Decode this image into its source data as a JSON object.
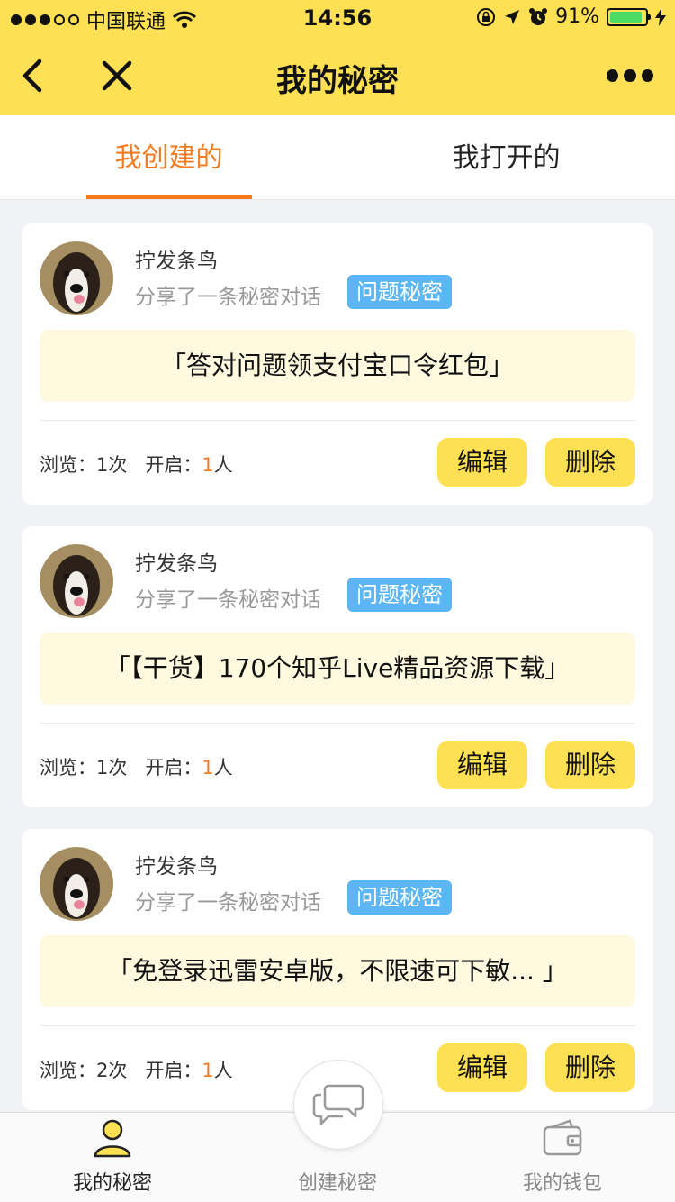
{
  "status_bar": {
    "carrier": "中国联通",
    "time": "14:56",
    "battery_percent": "91%",
    "battery_level": 0.91
  },
  "nav": {
    "title": "我的秘密"
  },
  "tabs": [
    {
      "label": "我创建的",
      "active": true
    },
    {
      "label": "我打开的",
      "active": false
    }
  ],
  "cards": [
    {
      "user": "拧发条鸟",
      "action": "分享了一条秘密对话",
      "badge": "问题秘密",
      "content": "「答对问题领支付宝口令红包」",
      "views_label": "浏览：",
      "views": "1次",
      "opens_label": "开启：",
      "opens_num": "1",
      "opens_unit": "人",
      "edit": "编辑",
      "delete": "删除"
    },
    {
      "user": "拧发条鸟",
      "action": "分享了一条秘密对话",
      "badge": "问题秘密",
      "content": "「【干货】170个知乎Live精品资源下载」",
      "views_label": "浏览：",
      "views": "1次",
      "opens_label": "开启：",
      "opens_num": "1",
      "opens_unit": "人",
      "edit": "编辑",
      "delete": "删除"
    },
    {
      "user": "拧发条鸟",
      "action": "分享了一条秘密对话",
      "badge": "问题秘密",
      "content": "「免登录迅雷安卓版，不限速可下敏...  」",
      "views_label": "浏览：",
      "views": "2次",
      "opens_label": "开启：",
      "opens_num": "1",
      "opens_unit": "人",
      "edit": "编辑",
      "delete": "删除"
    }
  ],
  "bottom_tabs": [
    {
      "label": "我的秘密",
      "icon": "user-icon",
      "active": true
    },
    {
      "label": "创建秘密",
      "icon": "chat-bubbles-icon",
      "active": false
    },
    {
      "label": "我的钱包",
      "icon": "wallet-icon",
      "active": false
    }
  ],
  "colors": {
    "brand_yellow": "#fde053",
    "accent_orange": "#f37b21",
    "badge_blue": "#5cb6f3",
    "content_bg": "#fff9e0"
  }
}
